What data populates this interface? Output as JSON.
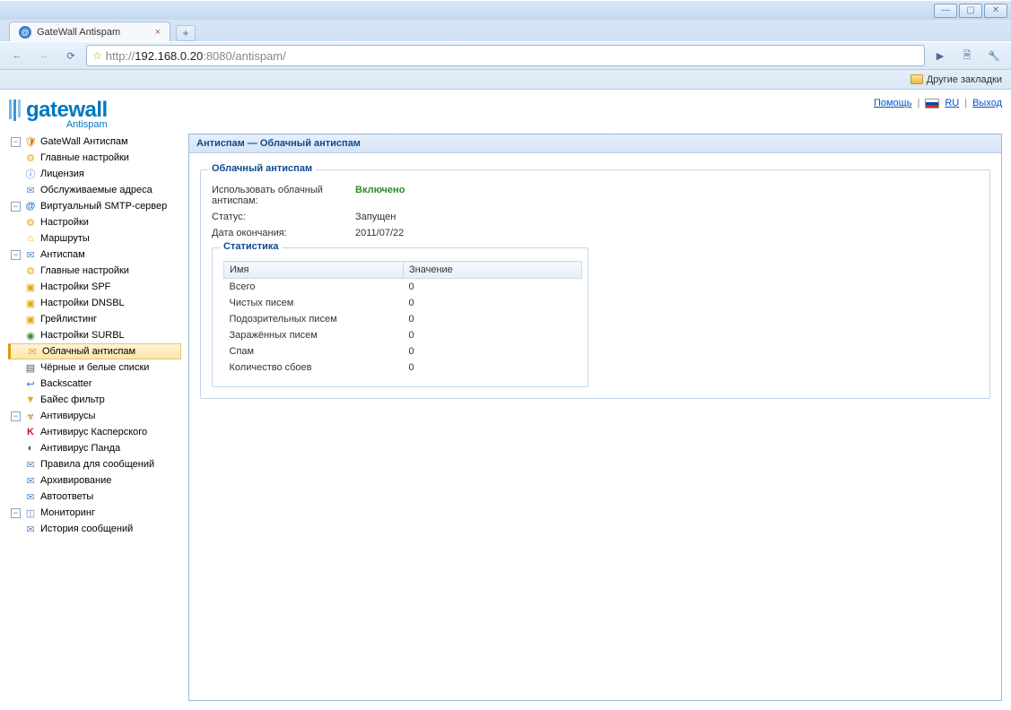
{
  "browser": {
    "tab_title": "GateWall Antispam",
    "url_proto": "http://",
    "url_host": "192.168.0.20",
    "url_port": ":8080",
    "url_path": "/antispam/",
    "bookmark_other": "Другие закладки"
  },
  "header": {
    "logo_main": "gatewall",
    "logo_sub": "Antispam",
    "help": "Помощь",
    "lang": "RU",
    "logout": "Выход"
  },
  "tree": {
    "root": "GateWall Антиспам",
    "root_items": {
      "main_settings": "Главные настройки",
      "license": "Лицензия",
      "addresses": "Обслуживаемые адреса"
    },
    "smtp": "Виртуальный SMTP-сервер",
    "smtp_items": {
      "settings": "Настройки",
      "routes": "Маршруты"
    },
    "antispam": "Антиспам",
    "antispam_items": {
      "main_settings": "Главные настройки",
      "spf": "Настройки SPF",
      "dnsbl": "Настройки DNSBL",
      "greylisting": "Грейлистинг",
      "surbl": "Настройки SURBL",
      "cloud": "Облачный антиспам",
      "bw": "Чёрные и белые списки",
      "backscatter": "Backscatter",
      "bayes": "Байес фильтр"
    },
    "antivirus": "Антивирусы",
    "antivirus_items": {
      "kaspersky": "Антивирус Касперского",
      "panda": "Антивирус Панда"
    },
    "rules": "Правила для сообщений",
    "archiving": "Архивирование",
    "autoreply": "Автоответы",
    "monitoring": "Мониторинг",
    "monitoring_items": {
      "history": "История сообщений"
    }
  },
  "breadcrumb": "Антиспам — Облачный антиспам",
  "cloud_panel": {
    "legend": "Облачный антиспам",
    "use_label": "Использовать облачный антиспам:",
    "use_value": "Включено",
    "status_label": "Статус:",
    "status_value": "Запущен",
    "expiry_label": "Дата окончания:",
    "expiry_value": "2011/07/22"
  },
  "stats": {
    "legend": "Статистика",
    "col_name": "Имя",
    "col_value": "Значение",
    "rows": {
      "total_l": "Всего",
      "total_v": "0",
      "clean_l": "Чистых писем",
      "clean_v": "0",
      "suspect_l": "Подозрительных писем",
      "suspect_v": "0",
      "infected_l": "Заражённых писем",
      "infected_v": "0",
      "spam_l": "Спам",
      "spam_v": "0",
      "fail_l": "Количество сбоев",
      "fail_v": "0"
    }
  }
}
